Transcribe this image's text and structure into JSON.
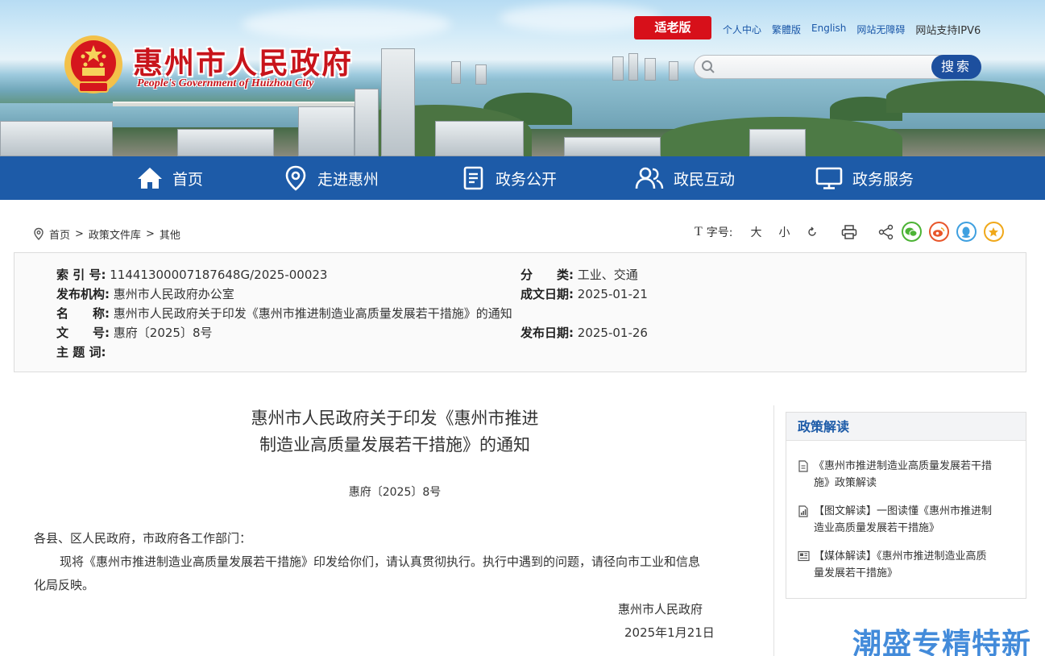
{
  "header": {
    "site_title": "惠州市人民政府",
    "site_subtitle": "People's Government of Huizhou City",
    "elder_mode": "适老版",
    "links": [
      "个人中心",
      "繁體版",
      "English",
      "网站无障碍"
    ],
    "ipv6": "网站支持IPV6",
    "search_placeholder": "",
    "search_button": "搜索"
  },
  "nav": {
    "items": [
      {
        "label": "首页",
        "icon": "home-icon"
      },
      {
        "label": "走进惠州",
        "icon": "location-pin-icon"
      },
      {
        "label": "政务公开",
        "icon": "document-icon"
      },
      {
        "label": "政民互动",
        "icon": "users-icon"
      },
      {
        "label": "政务服务",
        "icon": "monitor-icon"
      }
    ]
  },
  "breadcrumb": [
    "首页",
    "政策文件库",
    "其他"
  ],
  "tools": {
    "font_label": "字号:",
    "large": "大",
    "small": "小",
    "icons": [
      "font-size-icon",
      "reset-icon",
      "print-icon",
      "share-icon",
      "wechat-icon",
      "weibo-icon",
      "qq-icon",
      "favorite-icon"
    ]
  },
  "meta": {
    "index_label": "索 引 号:",
    "index_value": "11441300007187648G/2025-00023",
    "category_label": "分　　类:",
    "category_value": "工业、交通",
    "publisher_label": "发布机构:",
    "publisher_value": "惠州市人民政府办公室",
    "written_label": "成文日期:",
    "written_value": "2025-01-21",
    "name_label": "名　　称:",
    "name_value": "惠州市人民政府关于印发《惠州市推进制造业高质量发展若干措施》的通知",
    "docno_label": "文　　号:",
    "docno_value": "惠府〔2025〕8号",
    "pubdate_label": "发布日期:",
    "pubdate_value": "2025-01-26",
    "keywords_label": "主 题 词:",
    "keywords_value": ""
  },
  "article": {
    "title_line1": "惠州市人民政府关于印发《惠州市推进",
    "title_line2": "制造业高质量发展若干措施》的通知",
    "doc_number": "惠府〔2025〕8号",
    "salutation": "各县、区人民政府，市政府各工作部门：",
    "body_line1": "现将《惠州市推进制造业高质量发展若干措施》印发给你们，请认真贯彻执行。执行中遇到的问题，请径向市工业和信息",
    "body_line2": "化局反映。",
    "signer": "惠州市人民政府",
    "sign_date": "2025年1月21日"
  },
  "sidebar": {
    "title": "政策解读",
    "items": [
      {
        "icon": "document-icon",
        "line1": "《惠州市推进制造业高质量发展若干措",
        "line2": "施》政策解读"
      },
      {
        "icon": "chart-icon",
        "line1": "【图文解读】一图读懂《惠州市推进制",
        "line2": "造业高质量发展若干措施》"
      },
      {
        "icon": "newspaper-icon",
        "line1": "【媒体解读】《惠州市推进制造业高质",
        "line2": "量发展若干措施》"
      }
    ]
  },
  "watermark": "潮盛专精特新",
  "colors": {
    "nav_blue": "#1d5ba8",
    "brand_red": "#c8141b",
    "elder_red": "#d7101a"
  }
}
